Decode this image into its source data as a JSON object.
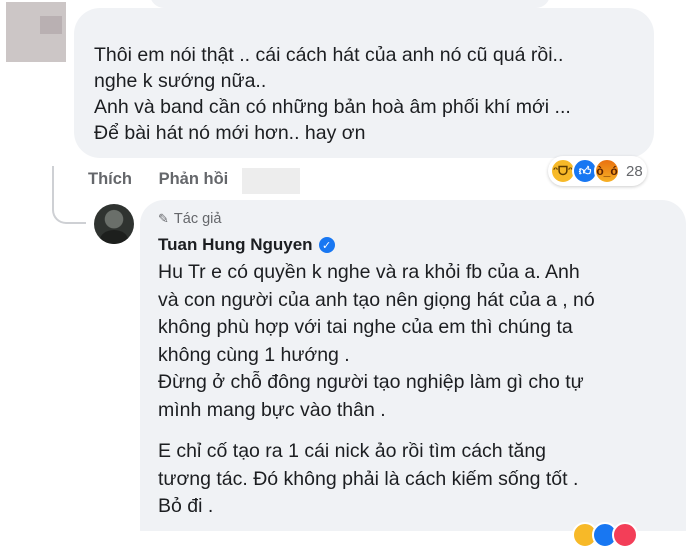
{
  "comment": {
    "lines": [
      "Thôi em nói thật .. cái cách hát của anh nó cũ quá rồi..",
      "nghe k sướng nữa..",
      "Anh và band cần có những bản hoà âm phối khí mới ...",
      "Để bài hát nó mới hơn.. hay ơn"
    ],
    "reaction_count": "28",
    "reaction_icons": [
      "haha-icon",
      "like-icon",
      "angry-icon"
    ]
  },
  "actions": {
    "like_label": "Thích",
    "reply_label": "Phản hồi"
  },
  "reply": {
    "badge": "Tác giả",
    "author": "Tuan Hung Nguyen",
    "verified": true,
    "paragraph1": [
      "Hu Tr e có quyền k nghe và ra khỏi fb của a. Anh",
      "và con người của anh tạo nên giọng hát của a , nó",
      "không phù hợp với tai nghe của em thì chúng ta",
      "không cùng 1 hướng .",
      "Đừng ở chỗ đông người tạo nghiệp làm gì cho tự",
      "mình mang bực vào thân ."
    ],
    "paragraph2": [
      "E chỉ cố tạo ra 1 cái nick ảo rồi tìm cách tăng",
      "tương tác. Đó không phải là cách kiếm sống tốt .",
      "Bỏ đi ."
    ]
  },
  "colors": {
    "bubble": "#f0f2f5",
    "secondary_text": "#65676b",
    "verified": "#1877f2"
  }
}
